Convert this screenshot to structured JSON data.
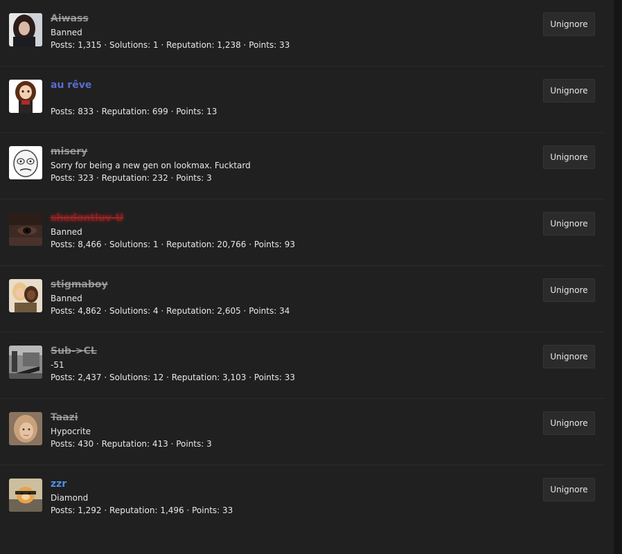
{
  "users": [
    {
      "name": "Aiwass",
      "style": "banned",
      "title": "Banned",
      "stats": "Posts: 1,315 · Solutions: 1 · Reputation: 1,238 · Points: 33",
      "button": "Unignore"
    },
    {
      "name": "au rêve",
      "style": "blue",
      "title": "",
      "stats": "Posts: 833 · Reputation: 699 · Points: 13",
      "button": "Unignore"
    },
    {
      "name": "misery",
      "style": "banned",
      "title": "Sorry for being a new gen on lookmax. Fucktard",
      "stats": "Posts: 323 · Reputation: 232 · Points: 3",
      "button": "Unignore"
    },
    {
      "name": "shedontluv-U",
      "style": "red",
      "title": "Banned",
      "stats": "Posts: 8,466 · Solutions: 1 · Reputation: 20,766 · Points: 93",
      "button": "Unignore"
    },
    {
      "name": "stigmaboy",
      "style": "banned",
      "title": "Banned",
      "stats": "Posts: 4,862 · Solutions: 4 · Reputation: 2,605 · Points: 34",
      "button": "Unignore"
    },
    {
      "name": "Sub->CL",
      "style": "banned",
      "title": "-51",
      "stats": "Posts: 2,437 · Solutions: 12 · Reputation: 3,103 · Points: 33",
      "button": "Unignore"
    },
    {
      "name": "Taazi",
      "style": "banned",
      "title": "Hypocrite",
      "stats": "Posts: 430 · Reputation: 413 · Points: 3",
      "button": "Unignore"
    },
    {
      "name": "zzr",
      "style": "bright-blue",
      "title": "Diamond",
      "stats": "Posts: 1,292 · Reputation: 1,496 · Points: 33",
      "button": "Unignore"
    }
  ]
}
